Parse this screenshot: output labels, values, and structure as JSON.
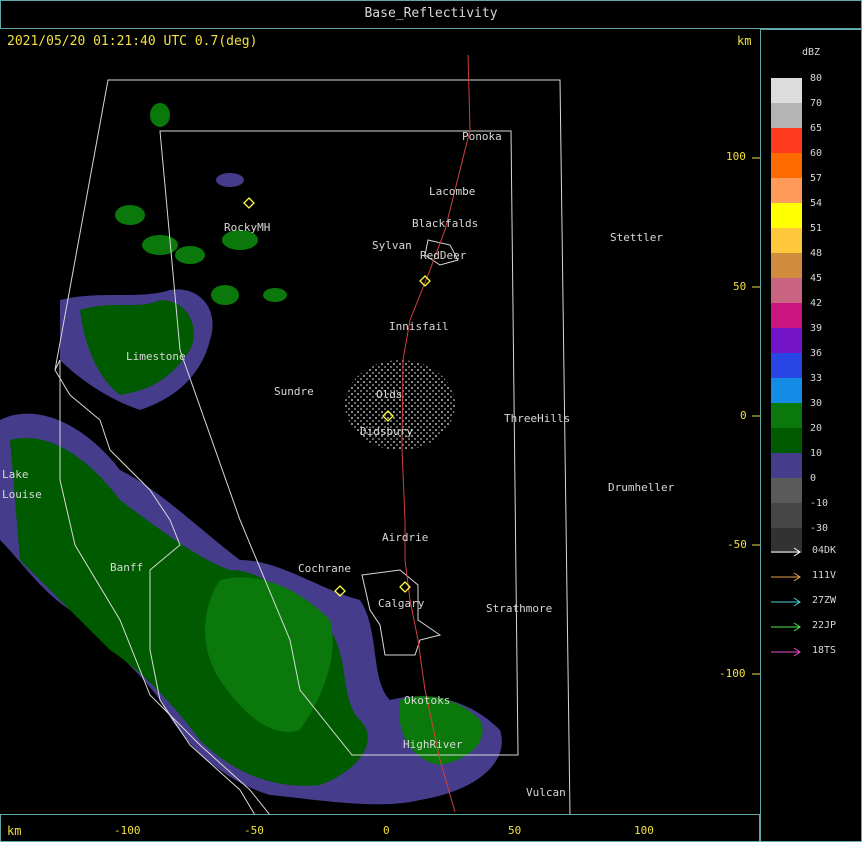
{
  "window": {
    "title": "Base_Reflectivity"
  },
  "header": {
    "timestamp": "2021/05/20 01:21:40 UTC 0.7(deg)",
    "unit": "km"
  },
  "footer": {
    "unit": "km"
  },
  "x_axis": {
    "ticks": [
      "-100",
      "-50",
      "0",
      "50",
      "100"
    ]
  },
  "y_axis": {
    "ticks": [
      "100",
      "50",
      "0",
      "-50",
      "-100"
    ]
  },
  "cities": [
    "Ponoka",
    "Lacombe",
    "Blackfalds",
    "Sylvan",
    "RedDeer",
    "Stettler",
    "RockyMH",
    "Innisfail",
    "Limestone",
    "Sundre",
    "Olds",
    "ThreeHills",
    "Didsbury",
    "Lake",
    "Louise",
    "Drumheller",
    "Airdrie",
    "Banff",
    "Cochrane",
    "Calgary",
    "Strathmore",
    "Okotoks",
    "HighRiver",
    "Vulcan"
  ],
  "legend": {
    "title": "dBZ",
    "scale": [
      {
        "label": "80",
        "color": "#dcdcdc"
      },
      {
        "label": "70",
        "color": "#b4b4b4"
      },
      {
        "label": "65",
        "color": "#ff3a1e"
      },
      {
        "label": "60",
        "color": "#ff6a00"
      },
      {
        "label": "57",
        "color": "#ff9a5a"
      },
      {
        "label": "54",
        "color": "#ffff00"
      },
      {
        "label": "51",
        "color": "#ffc83c"
      },
      {
        "label": "48",
        "color": "#d08c3c"
      },
      {
        "label": "45",
        "color": "#c86482"
      },
      {
        "label": "42",
        "color": "#cc1480"
      },
      {
        "label": "39",
        "color": "#7414c8"
      },
      {
        "label": "36",
        "color": "#2846e6"
      },
      {
        "label": "33",
        "color": "#148ce6"
      },
      {
        "label": "30",
        "color": "#0a780a"
      },
      {
        "label": "20",
        "color": "#005a00"
      },
      {
        "label": "10",
        "color": "#463c8c"
      },
      {
        "label": "0",
        "color": "#5a5a5a"
      },
      {
        "label": "-10",
        "color": "#464646"
      },
      {
        "label": "-30",
        "color": "#323232"
      }
    ]
  },
  "tracks": [
    {
      "label": "04DK",
      "color": "#ffffff"
    },
    {
      "label": "111V",
      "color": "#e6a050"
    },
    {
      "label": "27ZW",
      "color": "#50d2dc"
    },
    {
      "label": "22JP",
      "color": "#50e650"
    },
    {
      "label": "18TS",
      "color": "#e650c8"
    }
  ]
}
